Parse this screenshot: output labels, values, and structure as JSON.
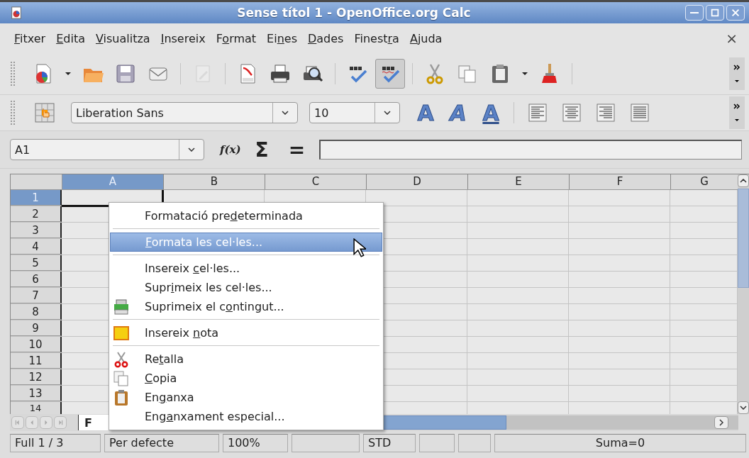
{
  "window": {
    "title": "Sense títol 1 - OpenOffice.org Calc"
  },
  "menu_bar": {
    "items": [
      {
        "key": "F",
        "rest": "itxer"
      },
      {
        "key": "E",
        "rest": "dita"
      },
      {
        "key": "V",
        "rest": "isualitza"
      },
      {
        "key": "I",
        "rest": "nsereix"
      },
      {
        "pre": "F",
        "key": "o",
        "rest": "rmat"
      },
      {
        "pre": "Ei",
        "key": "n",
        "rest": "es"
      },
      {
        "key": "D",
        "rest": "ades"
      },
      {
        "pre": "Finest",
        "key": "r",
        "rest": "a"
      },
      {
        "key": "A",
        "rest": "juda"
      }
    ],
    "close": "×"
  },
  "standard_toolbar": [
    {
      "kind": "new",
      "dropdown": true,
      "on": false,
      "disabled": false
    },
    {
      "kind": "open",
      "on": false,
      "disabled": false
    },
    {
      "kind": "save",
      "on": false,
      "disabled": false
    },
    {
      "kind": "mail",
      "on": false,
      "disabled": false
    },
    {
      "kind": "separator"
    },
    {
      "kind": "edit",
      "on": false,
      "disabled": true
    },
    {
      "kind": "separator"
    },
    {
      "kind": "pdf",
      "on": false,
      "disabled": false
    },
    {
      "kind": "print",
      "on": false,
      "disabled": false
    },
    {
      "kind": "preview",
      "on": false,
      "disabled": false
    },
    {
      "kind": "separator"
    },
    {
      "kind": "spell",
      "on": false,
      "disabled": false
    },
    {
      "kind": "autospell",
      "on": true,
      "disabled": false
    },
    {
      "kind": "separator"
    },
    {
      "kind": "cut",
      "on": false,
      "disabled": false
    },
    {
      "kind": "copy",
      "on": false,
      "disabled": false
    },
    {
      "kind": "paste",
      "dropdown": true,
      "on": false,
      "disabled": false
    },
    {
      "kind": "brush",
      "on": false,
      "disabled": false
    },
    {
      "kind": "separator"
    }
  ],
  "formatting_toolbar": {
    "font_name": "Liberation Sans",
    "font_size": "10",
    "text_styles": [
      {
        "kind": "bold",
        "glyph": "A"
      },
      {
        "kind": "italic",
        "glyph": "A"
      },
      {
        "kind": "underline",
        "glyph": "A"
      }
    ]
  },
  "formula_bar": {
    "name_box": "A1",
    "function_wizard": "f(x)",
    "sum": "Σ",
    "equals": "="
  },
  "sheet": {
    "columns": [
      {
        "label": "A",
        "selected": true
      },
      {
        "label": "B",
        "selected": false
      },
      {
        "label": "C",
        "selected": false
      },
      {
        "label": "D",
        "selected": false
      },
      {
        "label": "E",
        "selected": false
      },
      {
        "label": "F",
        "selected": false
      },
      {
        "label": "G",
        "selected": false
      }
    ],
    "rows": [
      {
        "label": "1",
        "selected": true
      },
      {
        "label": "2",
        "selected": false
      },
      {
        "label": "3",
        "selected": false
      },
      {
        "label": "4",
        "selected": false
      },
      {
        "label": "5",
        "selected": false
      },
      {
        "label": "6",
        "selected": false
      },
      {
        "label": "7",
        "selected": false
      },
      {
        "label": "8",
        "selected": false
      },
      {
        "label": "9",
        "selected": false
      },
      {
        "label": "10",
        "selected": false
      },
      {
        "label": "11",
        "selected": false
      },
      {
        "label": "12",
        "selected": false
      },
      {
        "label": "13",
        "selected": false
      },
      {
        "label": "14",
        "selected": false
      }
    ],
    "tabs": [
      {
        "label": "F",
        "selected": true
      }
    ]
  },
  "context_menu": [
    {
      "kind": "plain",
      "pre": "Formatació pre",
      "key": "d",
      "rest": "eterminada",
      "selected": false
    },
    {
      "kind": "separator"
    },
    {
      "kind": "plain",
      "key": "F",
      "rest": "ormata les cel·les...",
      "selected": true
    },
    {
      "kind": "separator"
    },
    {
      "kind": "plain",
      "pre": "Insereix ",
      "key": "c",
      "rest": "el·les...",
      "selected": false
    },
    {
      "kind": "plain",
      "pre": "Supr",
      "key": "i",
      "rest": "meix les cel·les...",
      "selected": false
    },
    {
      "kind": "delete-contents",
      "pre": "Suprimeix el c",
      "key": "o",
      "rest": "ntingut...",
      "selected": false
    },
    {
      "kind": "separator"
    },
    {
      "kind": "note",
      "pre": "Insereix ",
      "key": "n",
      "rest": "ota",
      "selected": false
    },
    {
      "kind": "separator"
    },
    {
      "kind": "cut",
      "pre": "Re",
      "key": "t",
      "rest": "alla",
      "selected": false
    },
    {
      "kind": "copy",
      "key": "C",
      "rest": "opia",
      "selected": false
    },
    {
      "kind": "paste",
      "pre": "En",
      "key": "g",
      "rest": "anxa",
      "selected": false
    },
    {
      "kind": "plain",
      "pre": "Eng",
      "key": "a",
      "rest": "nxament especial...",
      "selected": false
    }
  ],
  "status_bar": [
    "Full 1 / 3",
    "Per defecte",
    "100%",
    "STD",
    "Suma=0"
  ]
}
